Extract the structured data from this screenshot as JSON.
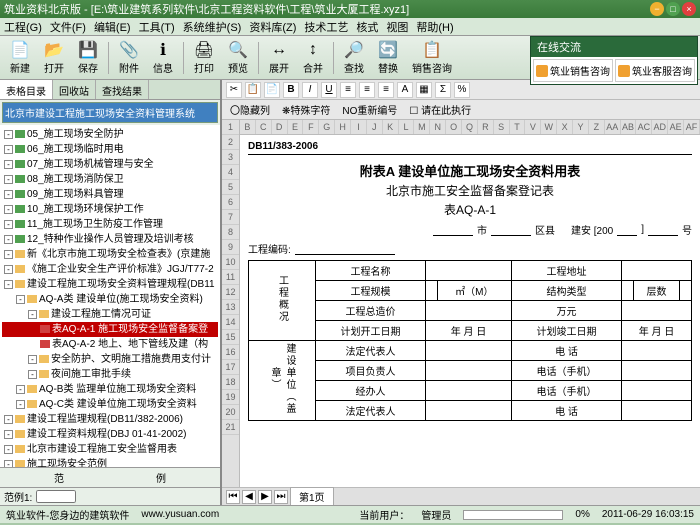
{
  "window": {
    "title": "筑业资料北京版 - [E:\\筑业建筑系列软件\\北京工程资料软件\\工程\\筑业大厦工程.xyz1]"
  },
  "menu": [
    "工程(G)",
    "文件(F)",
    "编辑(E)",
    "工具(T)",
    "系统维护(S)",
    "资料库(Z)",
    "技术工艺",
    "核式",
    "视图",
    "帮助(H)"
  ],
  "toolbar": [
    {
      "icon": "📄",
      "label": "新建"
    },
    {
      "icon": "📂",
      "label": "打开"
    },
    {
      "icon": "💾",
      "label": "保存"
    },
    {
      "sep": true
    },
    {
      "icon": "📎",
      "label": "附件"
    },
    {
      "icon": "ℹ",
      "label": "信息"
    },
    {
      "sep": true
    },
    {
      "icon": "🖨",
      "label": "打印"
    },
    {
      "icon": "🔍",
      "label": "预览"
    },
    {
      "sep": true
    },
    {
      "icon": "↔",
      "label": "展开"
    },
    {
      "icon": "↕",
      "label": "合并"
    },
    {
      "sep": true
    },
    {
      "icon": "🔎",
      "label": "查找"
    },
    {
      "icon": "🔄",
      "label": "替换"
    },
    {
      "icon": "📋",
      "label": "销售咨询"
    }
  ],
  "chat": {
    "title": "在线交流",
    "btn1": "筑业销售咨询",
    "btn2": "筑业客服咨询"
  },
  "left_tabs": [
    "表格目录",
    "回收站",
    "查找结果"
  ],
  "dropdown": "北京市建设工程施工现场安全资料管理系统",
  "tree": [
    {
      "lvl": 0,
      "exp": "-",
      "ico": "g",
      "txt": "05_施工现场安全防护"
    },
    {
      "lvl": 0,
      "exp": "-",
      "ico": "g",
      "txt": "06_施工现场临时用电"
    },
    {
      "lvl": 0,
      "exp": "-",
      "ico": "g",
      "txt": "07_施工现场机械管理与安全"
    },
    {
      "lvl": 0,
      "exp": "-",
      "ico": "g",
      "txt": "08_施工现场消防保卫"
    },
    {
      "lvl": 0,
      "exp": "-",
      "ico": "g",
      "txt": "09_施工现场料具管理"
    },
    {
      "lvl": 0,
      "exp": "-",
      "ico": "g",
      "txt": "10_施工现场环境保护工作"
    },
    {
      "lvl": 0,
      "exp": "-",
      "ico": "g",
      "txt": "11_施工现场卫生防疫工作管理"
    },
    {
      "lvl": 0,
      "exp": "-",
      "ico": "g",
      "txt": "12_特种作业操作人员管理及培训考核"
    },
    {
      "lvl": 0,
      "exp": "-",
      "ico": "",
      "txt": "新《北京市施工现场安全检查表》(京建施"
    },
    {
      "lvl": 0,
      "exp": "-",
      "ico": "",
      "txt": "《施工企业安全生产评价标准》JGJ/T77-2"
    },
    {
      "lvl": 0,
      "exp": "-",
      "ico": "",
      "txt": "建设工程施工现场安全资料管理规程(DB11"
    },
    {
      "lvl": 1,
      "exp": "-",
      "ico": "",
      "txt": "AQ-A类 建设单位(施工现场安全资料)"
    },
    {
      "lvl": 2,
      "exp": "-",
      "ico": "",
      "txt": "建设工程施工情况可证"
    },
    {
      "lvl": 3,
      "exp": "",
      "ico": "r",
      "txt": "表AQ-A-1 施工现场安全监督备案登",
      "sel": true
    },
    {
      "lvl": 3,
      "exp": "",
      "ico": "r",
      "txt": "表AQ-A-2 地上、地下管线及建（构"
    },
    {
      "lvl": 2,
      "exp": "-",
      "ico": "",
      "txt": "安全防护、文明施工措施费用支付计"
    },
    {
      "lvl": 2,
      "exp": "-",
      "ico": "",
      "txt": "夜间施工审批手续"
    },
    {
      "lvl": 1,
      "exp": "-",
      "ico": "",
      "txt": "AQ-B类 监理单位施工现场安全资料"
    },
    {
      "lvl": 1,
      "exp": "-",
      "ico": "",
      "txt": "AQ-C类 建设单位施工现场安全资料"
    },
    {
      "lvl": 0,
      "exp": "-",
      "ico": "",
      "txt": "建设工程监理规程(DB11/382-2006)"
    },
    {
      "lvl": 0,
      "exp": "-",
      "ico": "",
      "txt": "建设工程资料规程(DBJ 01-41-2002)"
    },
    {
      "lvl": 0,
      "exp": "-",
      "ico": "",
      "txt": "北京市建设工程施工安全监督用表"
    },
    {
      "lvl": 0,
      "exp": "-",
      "ico": "",
      "txt": "施工现场安全范例"
    },
    {
      "lvl": 0,
      "exp": "-",
      "ico": "",
      "txt": "北京市建设工程现场施工安全监督(2009)"
    }
  ],
  "left_foot": {
    "c1": "范",
    "c2": "例"
  },
  "range_label": "范例1:",
  "edit_tb2": {
    "hide": "〇隐藏列",
    "spec": "❋特殊字符",
    "reno": "NO重新编号",
    "copy": "☐ 请在此执行"
  },
  "cols": [
    "B",
    "C",
    "D",
    "E",
    "F",
    "G",
    "H",
    "I",
    "J",
    "K",
    "L",
    "M",
    "N",
    "O",
    "Q",
    "R",
    "S",
    "T",
    "V",
    "W",
    "X",
    "Y",
    "Z",
    "AA",
    "AB",
    "AC",
    "AD",
    "AE",
    "AF"
  ],
  "doc": {
    "code": "DB11/383-2006",
    "title": "附表A 建设单位施工现场安全资料用表",
    "subtitle": "北京市施工安全监督备案登记表",
    "formno": "表AQ-A-1",
    "row1": {
      "a": "市",
      "b": "区县",
      "c": "建安 [200",
      "d": "]",
      "e": "号"
    },
    "row2_label": "工程编码:",
    "tbl": {
      "side": "工程概况",
      "r1a": "工程名称",
      "r1b": "工程地址",
      "r2a": "工程规模",
      "r2b": "㎡（M）",
      "r2c": "结构类型",
      "r2d": "层数",
      "r3a": "工程总造价",
      "r3b": "万元",
      "r4a": "计划开工日期",
      "r4b": "年  月  日",
      "r4c": "计划竣工日期",
      "r4d": "年  月  日",
      "side2": "建设单位（盖章）",
      "r5a": "法定代表人",
      "r5b": "电  话",
      "r6a": "项目负责人",
      "r6b": "电话（手机）",
      "r7a": "经办人",
      "r7b": "电话（手机）",
      "r8a": "法定代表人",
      "r8b": "电  话"
    }
  },
  "sheet_tab": "第1页",
  "status": {
    "brand": "筑业软件-您身边的建筑软件",
    "url": "www.yusuan.com",
    "user_label": "当前用户：",
    "user": "管理员",
    "pct": "0%",
    "time": "2011-06-29 16:03:15"
  }
}
